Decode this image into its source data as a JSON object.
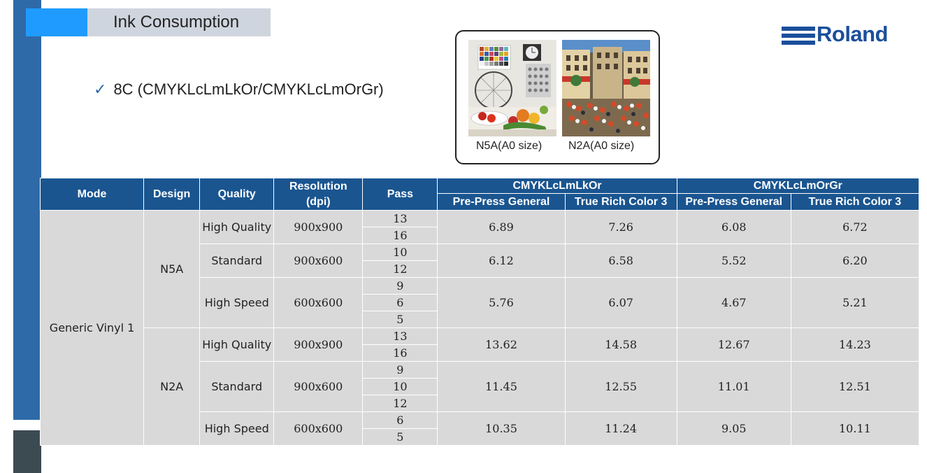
{
  "header": {
    "title": "Ink Consumption",
    "brand": "Roland"
  },
  "config": {
    "check": "✓",
    "text": "8C (CMYKLcLmLkOr/CMYKLcLmOrGr)"
  },
  "samples": [
    {
      "icon": "test-chart-image",
      "caption": "N5A(A0 size)"
    },
    {
      "icon": "street-scene-image",
      "caption": "N2A(A0 size)"
    }
  ],
  "table": {
    "headers": {
      "mode": "Mode",
      "design": "Design",
      "quality": "Quality",
      "resolution": "Resolution\n(dpi)",
      "pass": "Pass",
      "group1": "CMYKLcLmLkOr",
      "group2": "CMYKLcLmOrGr",
      "sub": [
        "Pre-Press General",
        "True Rich Color 3",
        "Pre-Press General",
        "True Rich Color 3"
      ]
    },
    "mode": "Generic Vinyl 1",
    "designs": [
      {
        "name": "N5A",
        "rows": [
          {
            "quality": "High Quality",
            "resolution": "900x900",
            "passes": [
              "13",
              "16"
            ],
            "values": [
              "6.89",
              "7.26",
              "6.08",
              "6.72"
            ]
          },
          {
            "quality": "Standard",
            "resolution": "900x600",
            "passes": [
              "10",
              "12"
            ],
            "values": [
              "6.12",
              "6.58",
              "5.52",
              "6.20"
            ]
          },
          {
            "quality": "High Speed",
            "resolution": "600x600",
            "passes": [
              "9",
              "6",
              "5"
            ],
            "values": [
              "5.76",
              "6.07",
              "4.67",
              "5.21"
            ]
          }
        ]
      },
      {
        "name": "N2A",
        "rows": [
          {
            "quality": "High Quality",
            "resolution": "900x900",
            "passes": [
              "13",
              "16"
            ],
            "values": [
              "13.62",
              "14.58",
              "12.67",
              "14.23"
            ]
          },
          {
            "quality": "Standard",
            "resolution": "900x600",
            "passes": [
              "9",
              "10",
              "12"
            ],
            "values": [
              "11.45",
              "12.55",
              "11.01",
              "12.51"
            ]
          },
          {
            "quality": "High Speed",
            "resolution": "600x600",
            "passes": [
              "6",
              "5"
            ],
            "values": [
              "10.35",
              "11.24",
              "9.05",
              "10.11"
            ]
          }
        ]
      }
    ]
  },
  "colors": {
    "header_blue": "#1a5590",
    "cell_gray": "#d9d9d9",
    "accent_blue": "#1f9bff",
    "sidebar_blue": "#2e6aa8",
    "brand_blue": "#1b4f9c"
  }
}
